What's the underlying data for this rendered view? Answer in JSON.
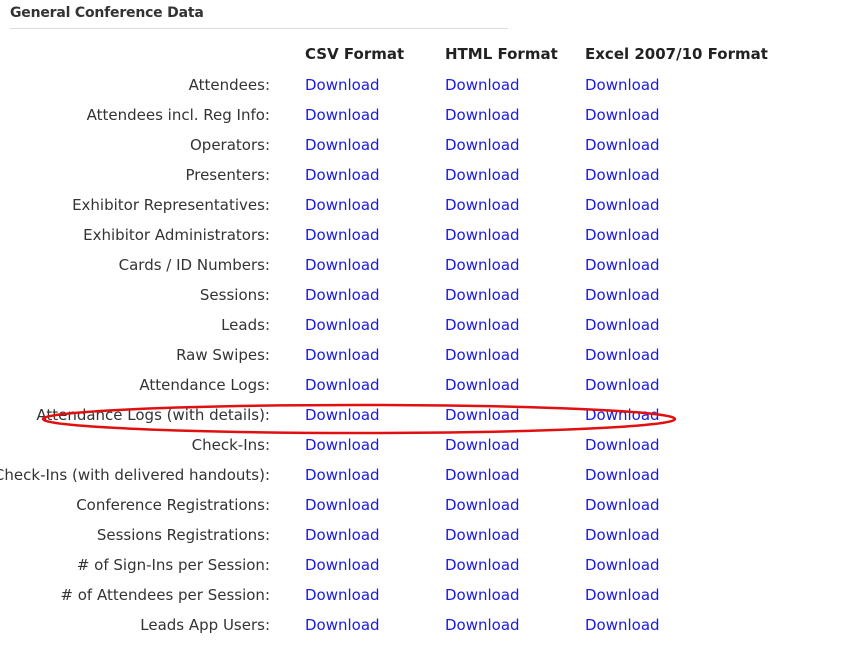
{
  "section": {
    "title": "General Conference Data"
  },
  "columns": [
    {
      "label": "CSV Format"
    },
    {
      "label": "HTML Format"
    },
    {
      "label": "Excel 2007/10 Format"
    }
  ],
  "link_text": "Download",
  "rows": [
    {
      "label": "Attendees:"
    },
    {
      "label": "Attendees incl. Reg Info:"
    },
    {
      "label": "Operators:"
    },
    {
      "label": "Presenters:"
    },
    {
      "label": "Exhibitor Representatives:"
    },
    {
      "label": "Exhibitor Administrators:"
    },
    {
      "label": "Cards / ID Numbers:"
    },
    {
      "label": "Sessions:"
    },
    {
      "label": "Leads:"
    },
    {
      "label": "Raw Swipes:"
    },
    {
      "label": "Attendance Logs:"
    },
    {
      "label": "Attendance Logs (with details):"
    },
    {
      "label": "Check-Ins:"
    },
    {
      "label": "Check-Ins (with delivered handouts):"
    },
    {
      "label": "Conference Registrations:"
    },
    {
      "label": "Sessions Registrations:"
    },
    {
      "label": "# of Sign-Ins per Session:"
    },
    {
      "label": "# of Attendees per Session:"
    },
    {
      "label": "Leads App Users:"
    }
  ],
  "colors": {
    "link": "#1a1ae6",
    "annotation": "#e01010",
    "text": "#333333"
  },
  "annotation": {
    "shape": "ellipse",
    "highlighted_row": 11
  }
}
